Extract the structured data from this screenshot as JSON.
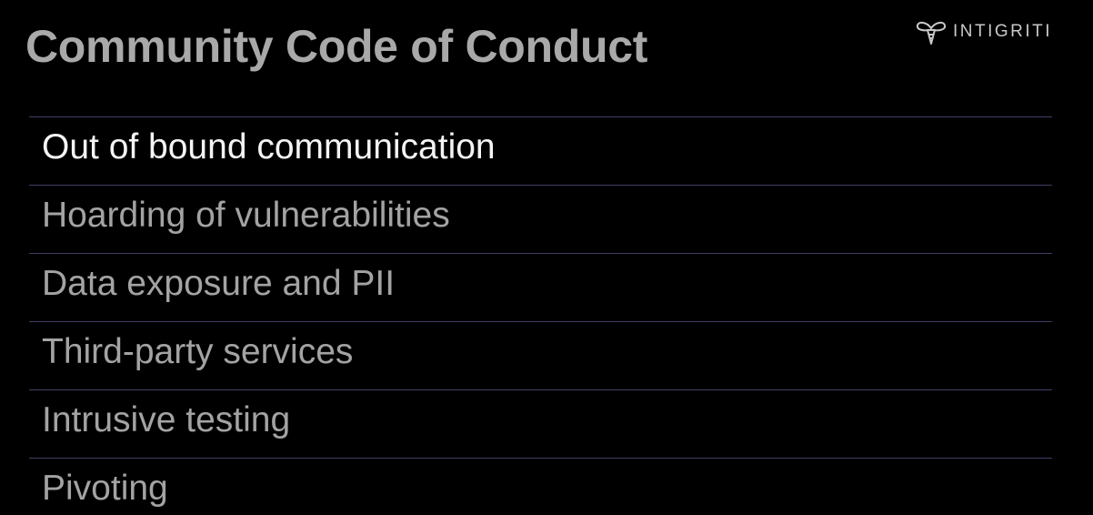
{
  "slide": {
    "title": "Community Code of Conduct"
  },
  "logo": {
    "icon": "bee-icon",
    "text": "INTIGRITI"
  },
  "list": {
    "items": [
      {
        "label": "Out of bound communication",
        "active": true
      },
      {
        "label": "Hoarding of vulnerabilities",
        "active": false
      },
      {
        "label": "Data exposure and PII",
        "active": false
      },
      {
        "label": "Third-party services",
        "active": false
      },
      {
        "label": "Intrusive testing",
        "active": false
      },
      {
        "label": "Pivoting",
        "active": false
      }
    ]
  },
  "colors": {
    "background": "#000000",
    "title": "#a9a9a9",
    "item_active": "#f4f4f4",
    "item_inactive": "#a3a3a3",
    "divider": "#3f3f66"
  }
}
